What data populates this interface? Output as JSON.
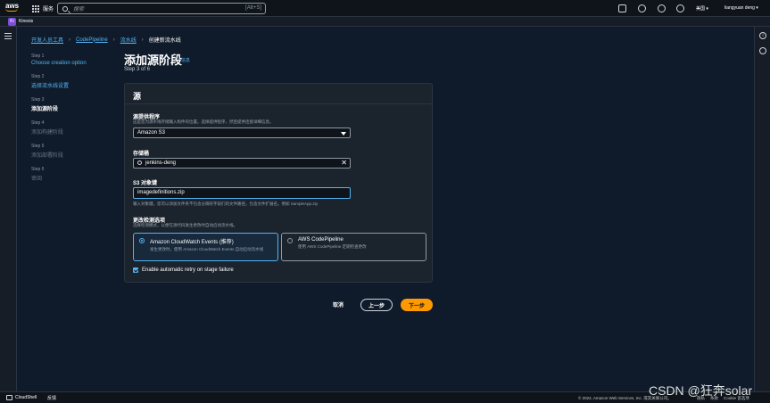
{
  "topnav": {
    "logo_text": "aws",
    "services_label": "服务",
    "search_placeholder": "搜索",
    "search_shortcut": "[Alt+S]",
    "region": "美国 ▾",
    "user": "liangyuan deng ▾"
  },
  "favorites": {
    "badge": "Ki",
    "label": "Kinesis"
  },
  "breadcrumb": {
    "items": [
      "开发人员工具",
      "CodePipeline",
      "流水线"
    ],
    "current": "创建新流水线"
  },
  "steps": [
    {
      "num": "Step 1",
      "label": "Choose creation option",
      "state": "link"
    },
    {
      "num": "Step 2",
      "label": "选择流水线设置",
      "state": "link"
    },
    {
      "num": "Step 3",
      "label": "添加源阶段",
      "state": "active"
    },
    {
      "num": "Step 4",
      "label": "添加构建阶段",
      "state": "disabled"
    },
    {
      "num": "Step 5",
      "label": "添加部署阶段",
      "state": "disabled"
    },
    {
      "num": "Step 6",
      "label": "审阅",
      "state": "disabled"
    }
  ],
  "header": {
    "title": "添加源阶段",
    "info": "信息",
    "sub": "Step 3 of 6"
  },
  "panel": {
    "title": "源",
    "provider": {
      "label": "源提供程序",
      "desc": "这是您为源水线存储输入构件的位置。选择提供程序，然后提供连接详细信息。",
      "value": "Amazon S3"
    },
    "bucket": {
      "label": "存储桶",
      "value": "jenkins-deng"
    },
    "object_key": {
      "label": "S3 对象键",
      "value": "imagedefinitions.zip",
      "desc": "输入对象键。您可以添加文件夹不包含分隔符字段们的文件路径，包含文件扩展名。例如 SampleApp.zip"
    },
    "change_detection": {
      "label": "更改检测选项",
      "desc": "选择检测模式，以便在源代码发生更改时自动启动流水线。",
      "options": [
        {
          "title": "Amazon CloudWatch Events (推荐)",
          "desc": "发生更改时，使用 Amazon CloudWatch Events 自动启动流水线",
          "selected": true
        },
        {
          "title": "AWS CodePipeline",
          "desc": "使用 AWS CodePipeline 定期检查更改",
          "selected": false
        }
      ]
    },
    "retry_label": "Enable automatic retry on stage failure"
  },
  "actions": {
    "cancel": "取消",
    "previous": "上一步",
    "next": "下一步"
  },
  "footer": {
    "cloudshell": "CloudShell",
    "feedback": "反馈",
    "copyright": "© 2024, Amazon Web Services, Inc. 或其关联公司。",
    "links": [
      "隐私",
      "条款",
      "Cookie 首选项"
    ]
  },
  "watermark": "CSDN @狂奔solar",
  "colors": {
    "accent": "#ff9900",
    "link": "#53b5f5",
    "background": "#0f1b2a"
  }
}
